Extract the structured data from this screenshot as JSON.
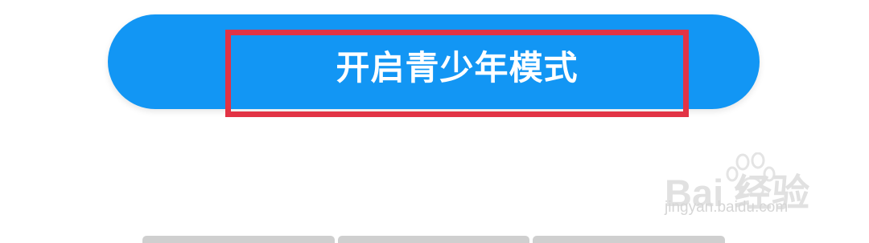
{
  "button": {
    "label": "开启青少年模式",
    "color": "#1296f4"
  },
  "annotation": {
    "color": "#e23345"
  },
  "watermark": {
    "main_text": "Bai 经验",
    "url_text": "jingyan.baidu.com",
    "icon": "paw-icon"
  },
  "bottom_tabs": {
    "count": 3
  }
}
